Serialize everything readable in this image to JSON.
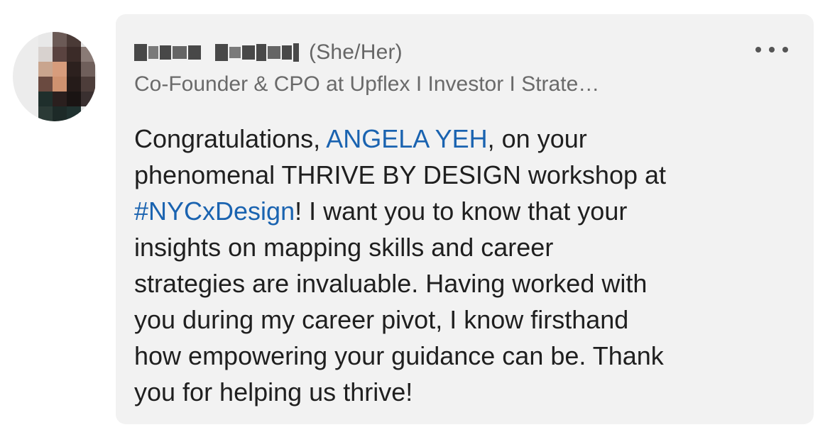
{
  "comment": {
    "author": {
      "pronouns": "(She/Her)",
      "headline": "Co-Founder & CPO at Upflex I Investor I Strate…"
    },
    "more_label": "•••",
    "body": {
      "l1_a": "Congratulations, ",
      "l1_mention": "ANGELA YEH",
      "l1_b": ", on your",
      "l2": "phenomenal THRIVE BY DESIGN workshop at",
      "l3_hashtag": "#NYCxDesign",
      "l3_b": "! I want you to know that your",
      "l4": "insights on mapping skills and career",
      "l5": "strategies are invaluable. Having worked with",
      "l6": "you during my career pivot, I know firsthand",
      "l7": "how empowering your guidance can be. Thank",
      "l8": "you for helping us thrive!"
    }
  },
  "colors": {
    "bubble_bg": "#f2f2f2",
    "mention": "#1a63b0",
    "body_text": "#1f1f1f",
    "secondary_text": "#6a6a6a"
  }
}
